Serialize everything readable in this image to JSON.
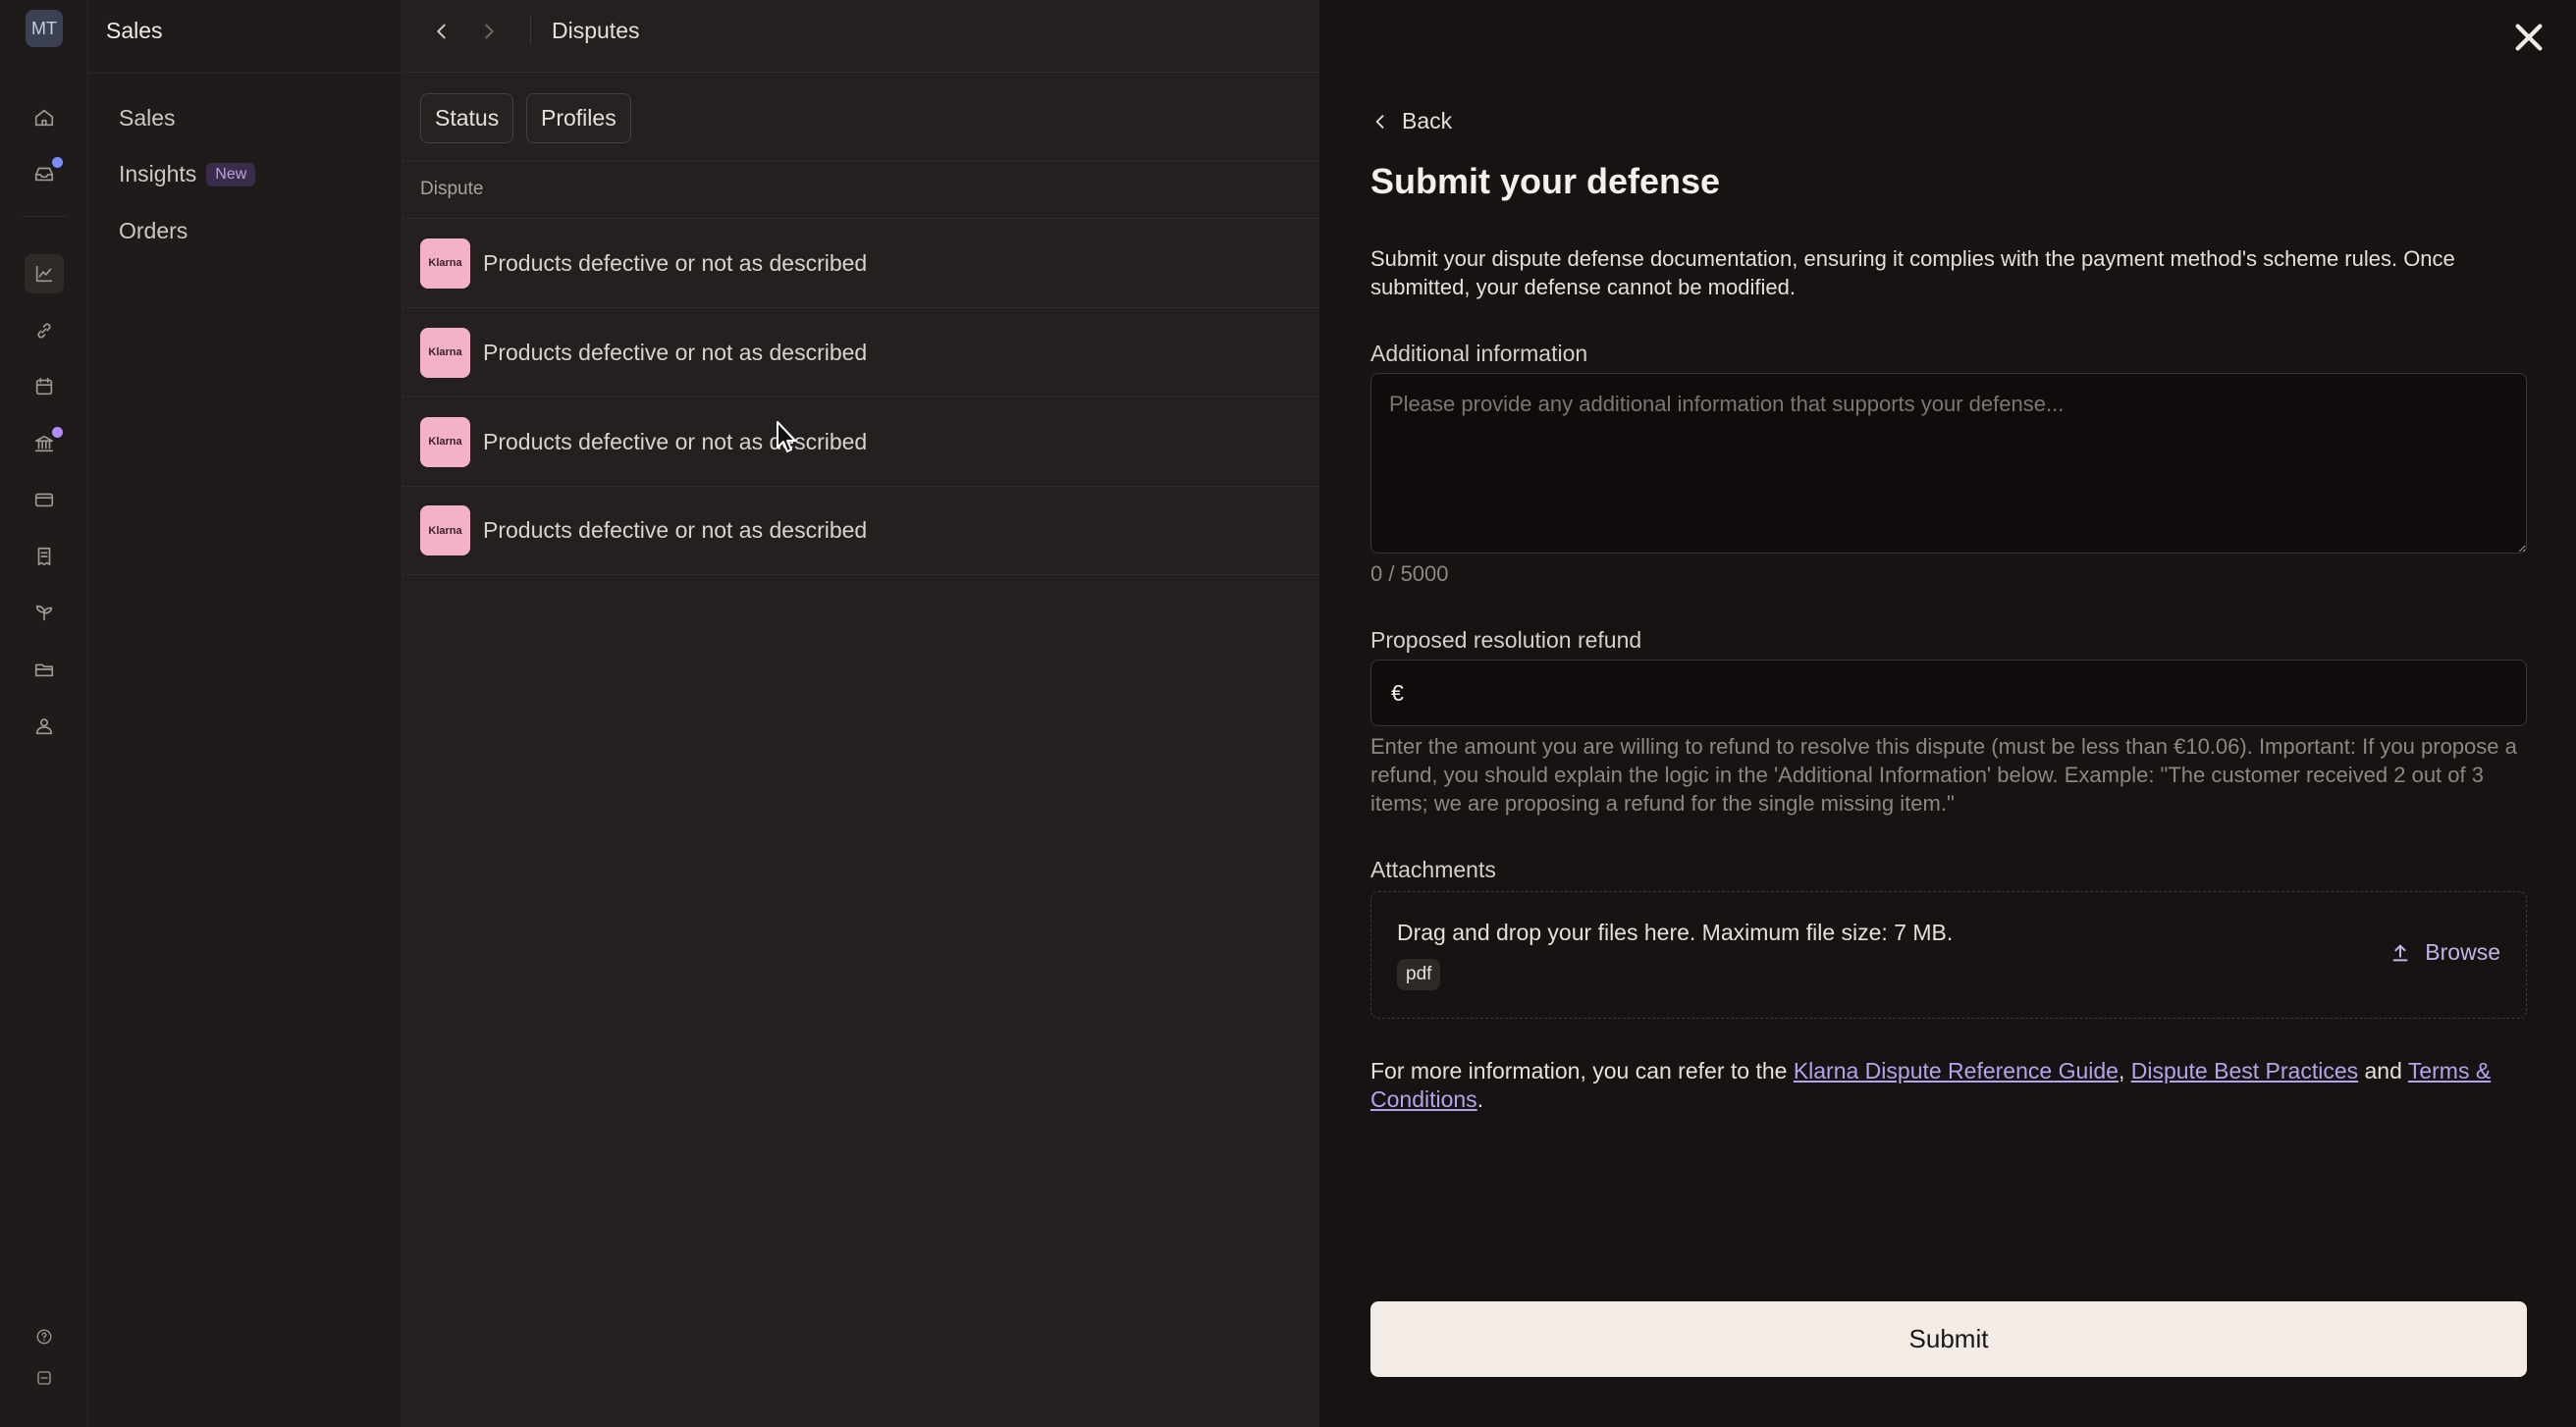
{
  "user": {
    "initials": "MT"
  },
  "section": {
    "title": "Sales"
  },
  "rail": {
    "icons": [
      "home-icon",
      "inbox-icon",
      "chart-icon",
      "link-icon",
      "calendar-icon",
      "bank-icon",
      "credit-card-icon",
      "receipt-icon",
      "plant-icon",
      "folder-icon",
      "users-icon",
      "help-icon",
      "settings-icon"
    ],
    "active": "chart-icon",
    "notification_color": "#7b8cff",
    "notification_color_alt": "#b58cff"
  },
  "nav": {
    "items": [
      {
        "label": "Sales"
      },
      {
        "label": "Insights",
        "badge": "New"
      },
      {
        "label": "Orders"
      }
    ]
  },
  "topbar": {
    "title": "Disputes"
  },
  "filters": {
    "status_label": "Status",
    "profiles_label": "Profiles"
  },
  "table": {
    "column_header": "Dispute",
    "logo_text": "Klarna",
    "rows": [
      {
        "reason": "Products defective or not as described"
      },
      {
        "reason": "Products defective or not as described"
      },
      {
        "reason": "Products defective or not as described"
      },
      {
        "reason": "Products defective or not as described"
      }
    ]
  },
  "panel": {
    "back_label": "Back",
    "title": "Submit your defense",
    "intro": "Submit your dispute defense documentation, ensuring it complies with the payment method's scheme rules. Once submitted, your defense cannot be modified.",
    "additional_info": {
      "label": "Additional information",
      "placeholder": "Please provide any additional information that supports your defense...",
      "value": "",
      "counter": "0 / 5000"
    },
    "refund": {
      "label": "Proposed resolution refund",
      "currency": "€",
      "value": "",
      "help": "Enter the amount you are willing to refund to resolve this dispute (must be less than €10.06). Important: If you propose a refund, you should explain the logic in the 'Additional Information' below. Example: \"The customer received 2 out of 3 items; we are proposing a refund for the single missing item.\""
    },
    "attachments": {
      "label": "Attachments",
      "drop_text": "Drag and drop your files here. Maximum file size: 7 MB.",
      "file_type": "pdf",
      "browse_label": "Browse"
    },
    "more_info": {
      "prefix": "For more information, you can refer to the ",
      "link1": "Klarna Dispute Reference Guide",
      "sep1": ", ",
      "link2": "Dispute Best Practices",
      "sep2": " and ",
      "link3": "Terms & Conditions",
      "suffix": "."
    },
    "submit_label": "Submit"
  },
  "colors": {
    "link": "#b7a3ec",
    "klarna_pink": "#f3b2c8",
    "panel_bg": "#171312"
  }
}
